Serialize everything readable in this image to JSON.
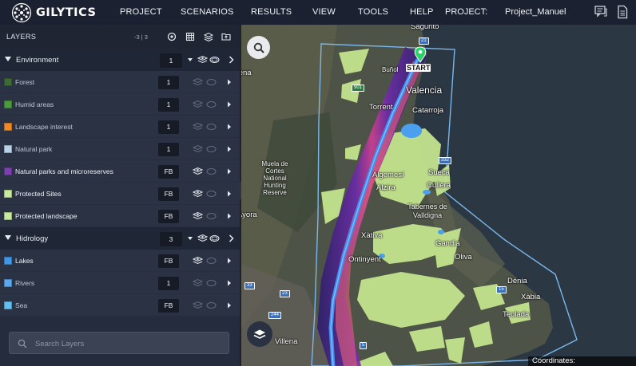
{
  "app": {
    "brand": "GILYTICS",
    "project_label": "PROJECT:",
    "project_name": "Project_Manuel"
  },
  "nav": [
    {
      "label": "PROJECT"
    },
    {
      "label": "SCENARIOS"
    },
    {
      "label": "RESULTS"
    },
    {
      "label": "VIEW"
    },
    {
      "label": "TOOLS"
    },
    {
      "label": "HELP"
    }
  ],
  "toolbar_icons": [
    "comments-icon",
    "document-icon"
  ],
  "sidebar": {
    "title": "LAYERS",
    "count": "-3 | 3",
    "header_icons": [
      "target-icon",
      "grid-icon",
      "layers-stack-icon",
      "folder-upload-icon"
    ],
    "groups": [
      {
        "name": "Environment",
        "value": "1",
        "layers": [
          {
            "name": "Forest",
            "value": "1",
            "color": "#3e6a34",
            "lit": false
          },
          {
            "name": "Humid areas",
            "value": "1",
            "color": "#4b9a3e",
            "lit": false
          },
          {
            "name": "Landscape interest",
            "value": "1",
            "color": "#f08a24",
            "lit": false
          },
          {
            "name": "Natural park",
            "value": "1",
            "color": "#b7d3ea",
            "lit": false
          },
          {
            "name": "Natural parks and microreserves",
            "value": "FB",
            "color": "#7a3fb0",
            "lit": true
          },
          {
            "name": "Protected Sites",
            "value": "FB",
            "color": "#c7eb9a",
            "lit": true
          },
          {
            "name": "Protected landscape",
            "value": "FB",
            "color": "#c7eb9a",
            "lit": true
          }
        ]
      },
      {
        "name": "Hidrology",
        "value": "3",
        "layers": [
          {
            "name": "Lakes",
            "value": "FB",
            "color": "#3e98ea",
            "lit": true
          },
          {
            "name": "Rivers",
            "value": "1",
            "color": "#5aa8ee",
            "lit": false
          },
          {
            "name": "Sea",
            "value": "FB",
            "color": "#5fc2f0",
            "lit": false
          }
        ]
      }
    ],
    "search_placeholder": "Search Layers"
  },
  "map": {
    "start_label": "START",
    "coordinates_label": "Coordinates:",
    "places": [
      {
        "name": "Sagunto"
      },
      {
        "name": "Valencia"
      },
      {
        "name": "Buñol"
      },
      {
        "name": "Torrent"
      },
      {
        "name": "Catarroja"
      },
      {
        "name": "Muela de Cortes National Hunting Reserve"
      },
      {
        "name": "Algemesí"
      },
      {
        "name": "Alzira"
      },
      {
        "name": "Sueca"
      },
      {
        "name": "Cullera"
      },
      {
        "name": "Tabernes de Valldigna"
      },
      {
        "name": "Xàtiva"
      },
      {
        "name": "Gandia"
      },
      {
        "name": "Oliva"
      },
      {
        "name": "Ontinyent"
      },
      {
        "name": "Dénia"
      },
      {
        "name": "Xàbia"
      },
      {
        "name": "Teulada"
      },
      {
        "name": "Villena"
      },
      {
        "name": "Requena"
      },
      {
        "name": "Ayora"
      }
    ],
    "road_signs": [
      "21",
      "901",
      "332",
      "23",
      "33",
      "244",
      "15",
      "5"
    ]
  }
}
